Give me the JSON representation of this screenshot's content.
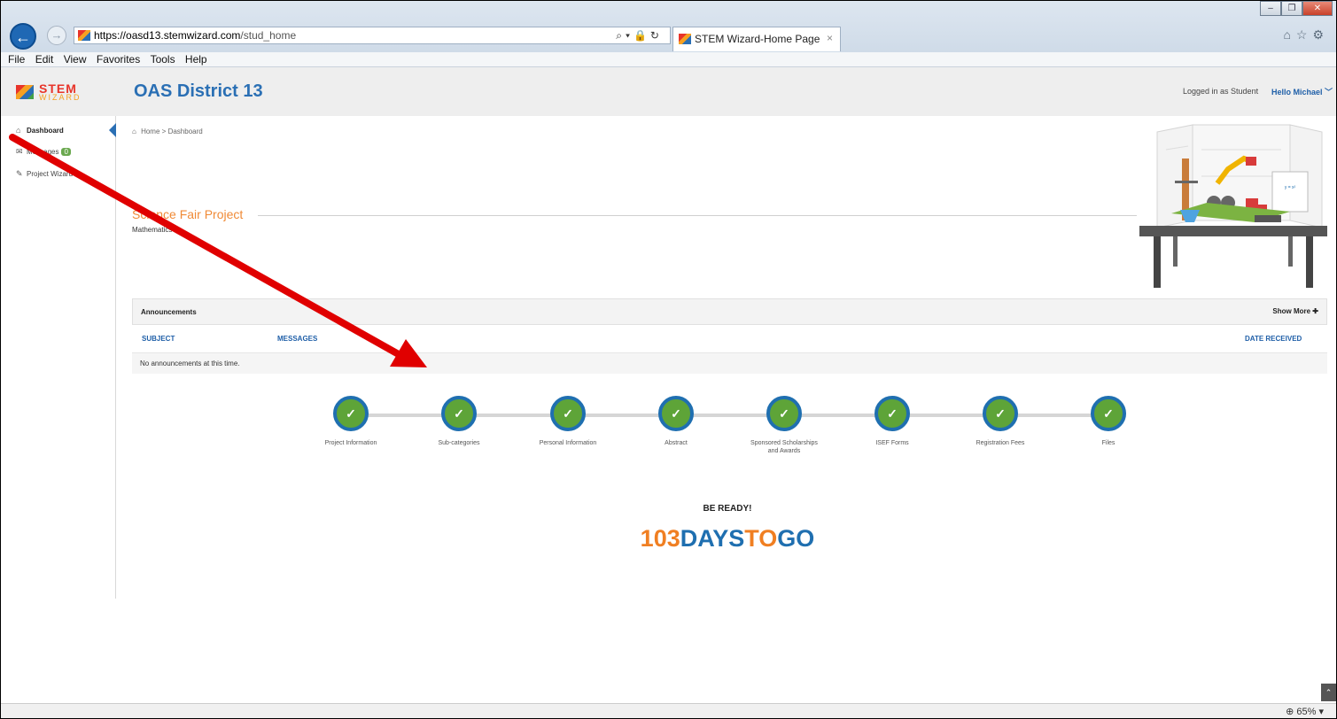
{
  "browser": {
    "url_host": "https://oasd13.stemwizard.com",
    "url_path": "/stud_home",
    "tab_title": "STEM Wizard-Home Page",
    "tab_close": "×",
    "menu": [
      "File",
      "Edit",
      "View",
      "Favorites",
      "Tools",
      "Help"
    ],
    "zoom": "65%"
  },
  "header": {
    "logo_stem": "STEM",
    "logo_wizard": "WIZARD",
    "district": "OAS District 13",
    "logged_in": "Logged in as Student",
    "hello": "Hello Michael"
  },
  "sidebar": {
    "items": [
      {
        "label": "Dashboard",
        "icon": "home-icon"
      },
      {
        "label": "Messages",
        "icon": "envelope-icon",
        "badge": "0"
      },
      {
        "label": "Project Wizard",
        "icon": "edit-icon"
      }
    ]
  },
  "breadcrumb": {
    "home": "Home",
    "sep": ">",
    "current": "Dashboard"
  },
  "project": {
    "title": "Science Fair Project",
    "subtitle": "Mathematics"
  },
  "announcements": {
    "title": "Announcements",
    "show_more": "Show More",
    "col_subject": "SUBJECT",
    "col_messages": "MESSAGES",
    "col_date": "DATE RECEIVED",
    "empty": "No announcements at this time."
  },
  "steps": [
    {
      "label": "Project Information"
    },
    {
      "label": "Sub-categories"
    },
    {
      "label": "Personal Information"
    },
    {
      "label": "Abstract"
    },
    {
      "label": "Sponsored Scholarships and Awards"
    },
    {
      "label": "ISEF Forms"
    },
    {
      "label": "Registration Fees"
    },
    {
      "label": "Files"
    }
  ],
  "countdown": {
    "ready": "BE READY!",
    "days": "103",
    "w1": "DAYS",
    "w2": "TO",
    "w3": "GO"
  },
  "colors": {
    "accent_blue": "#2a6fb4",
    "accent_orange": "#f07f22",
    "step_green": "#5ea438",
    "arrow_red": "#e00000"
  }
}
